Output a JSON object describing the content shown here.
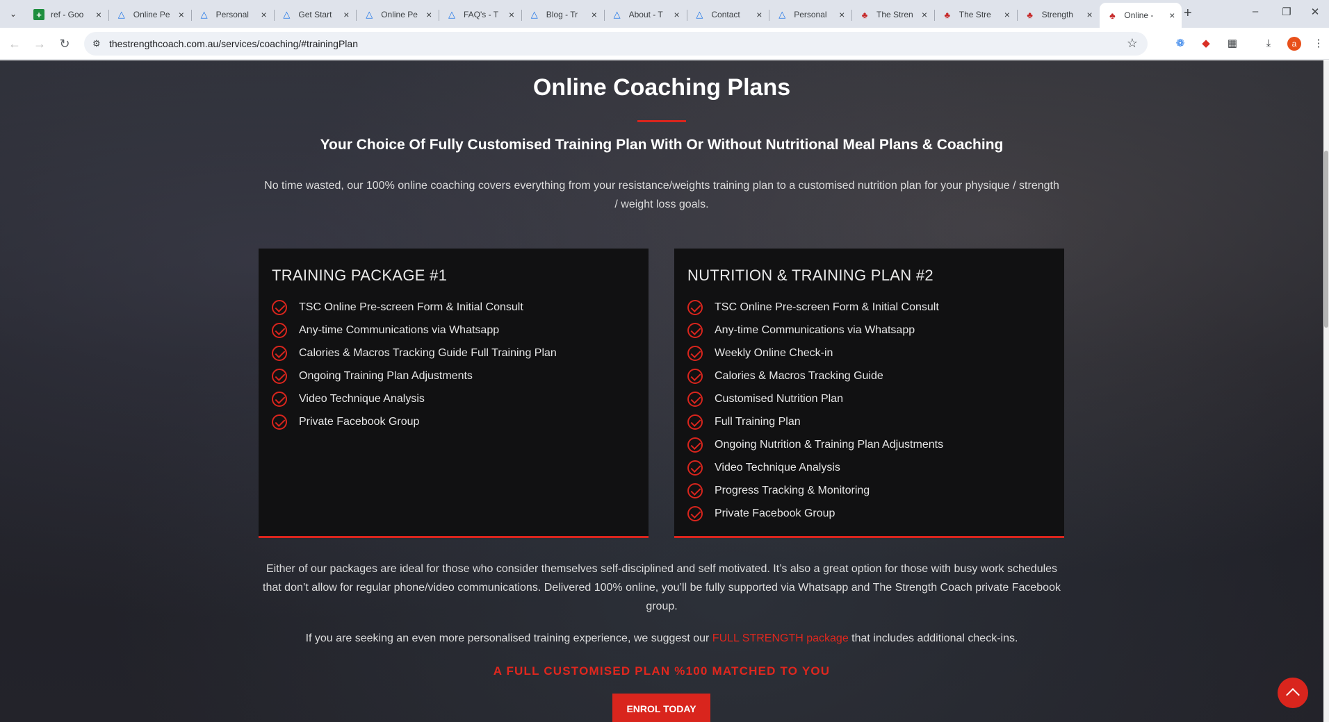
{
  "browser": {
    "tabs": [
      {
        "title": "ref - Goo",
        "icon": "sheets-icon"
      },
      {
        "title": "Online Pe",
        "icon": "triangle-icon"
      },
      {
        "title": "Personal",
        "icon": "triangle-icon"
      },
      {
        "title": "Get Start",
        "icon": "triangle-icon"
      },
      {
        "title": "Online Pe",
        "icon": "triangle-icon"
      },
      {
        "title": "FAQ's - T",
        "icon": "triangle-icon"
      },
      {
        "title": "Blog - Tr",
        "icon": "triangle-icon"
      },
      {
        "title": "About - T",
        "icon": "triangle-icon"
      },
      {
        "title": "Contact",
        "icon": "triangle-icon"
      },
      {
        "title": "Personal",
        "icon": "triangle-icon"
      },
      {
        "title": "The Stren",
        "icon": "tsc-icon"
      },
      {
        "title": "The Stre",
        "icon": "tsc-icon"
      },
      {
        "title": "Strength",
        "icon": "tsc-icon"
      },
      {
        "title": "Online -",
        "icon": "tsc-icon",
        "active": true
      }
    ],
    "url": "thestrengthcoach.com.au/services/coaching/#trainingPlan",
    "profile_initial": "a"
  },
  "page": {
    "title": "Online Coaching Plans",
    "subtitle": "Your Choice Of Fully Customised Training Plan With Or Without Nutritional Meal Plans & Coaching",
    "intro": "No time wasted, our 100% online coaching covers everything from your resistance/weights training plan to a customised nutrition plan for your physique / strength / weight loss goals.",
    "packages": [
      {
        "title": "TRAINING PACKAGE #1",
        "items": [
          "TSC Online Pre-screen Form & Initial Consult",
          "Any-time Communications via Whatsapp",
          "Calories & Macros Tracking Guide Full Training Plan",
          "Ongoing Training Plan Adjustments",
          "Video Technique Analysis",
          "Private Facebook Group"
        ]
      },
      {
        "title": "NUTRITION & TRAINING PLAN #2",
        "items": [
          "TSC Online Pre-screen Form & Initial Consult",
          "Any-time Communications via Whatsapp",
          "Weekly Online Check-in",
          "Calories & Macros Tracking Guide",
          "Customised Nutrition Plan",
          "Full Training Plan",
          "Ongoing Nutrition & Training Plan Adjustments",
          "Video Technique Analysis",
          "Progress Tracking & Monitoring",
          "Private Facebook Group"
        ]
      }
    ],
    "info_paragraph": "Either of our packages are ideal for those who consider themselves self-disciplined and self motivated. It’s also a great option for those with busy work schedules that don’t allow for regular phone/video communications. Delivered 100% online, you’ll be fully supported via Whatsapp and The Strength Coach private Facebook group.",
    "suggest_before": "If you are seeking an even more personalised training experience, we suggest our ",
    "suggest_link": "FULL STRENGTH package",
    "suggest_after": " that includes additional check-ins.",
    "tagline": "A FULL CUSTOMISED PLAN %100 MATCHED TO YOU",
    "cta_label": "ENROL TODAY"
  },
  "colors": {
    "accent": "#d9251d",
    "card_bg": "#111112"
  }
}
